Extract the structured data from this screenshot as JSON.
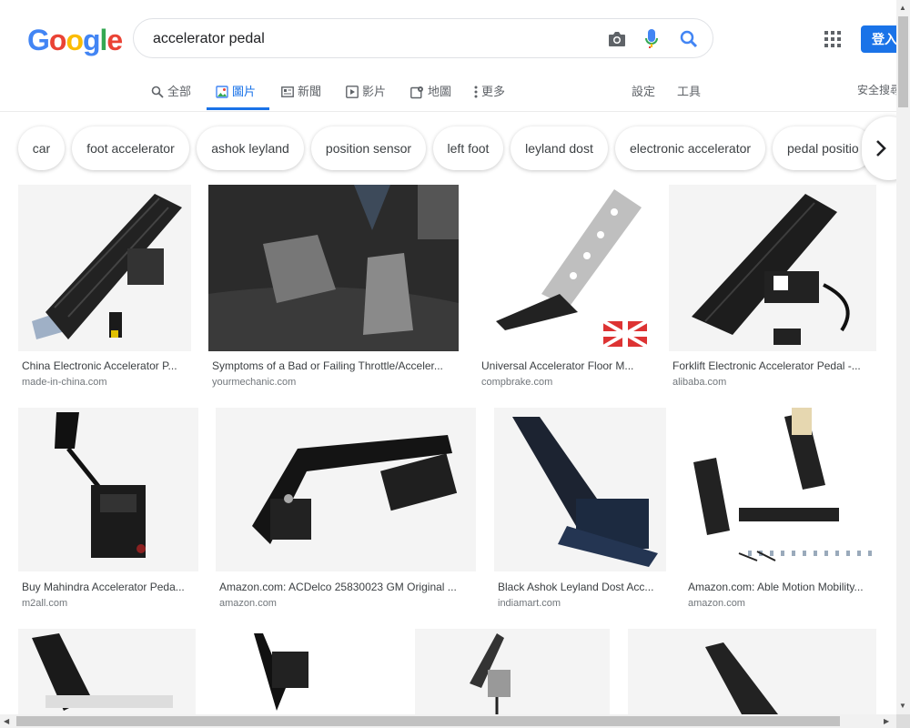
{
  "logo": {
    "letters": [
      "G",
      "o",
      "o",
      "g",
      "l",
      "e"
    ],
    "colors": [
      "#4285F4",
      "#EA4335",
      "#FBBC05",
      "#4285F4",
      "#34A853",
      "#EA4335"
    ]
  },
  "search": {
    "value": "accelerator pedal",
    "camera_icon": "camera-icon",
    "mic_icon": "mic-icon",
    "search_icon": "search-icon"
  },
  "header": {
    "apps_icon": "apps-grid-icon",
    "signin_label": "登入"
  },
  "tabs": [
    {
      "label": "全部",
      "icon": "search-icon"
    },
    {
      "label": "圖片",
      "icon": "image-icon"
    },
    {
      "label": "新聞",
      "icon": "news-icon"
    },
    {
      "label": "影片",
      "icon": "video-icon"
    },
    {
      "label": "地圖",
      "icon": "map-icon"
    },
    {
      "label": "更多",
      "icon": "more-icon"
    }
  ],
  "tools": {
    "settings": "設定",
    "tools": "工具",
    "safe_search": "安全搜尋"
  },
  "chips": [
    "car",
    "foot accelerator",
    "ashok leyland",
    "position sensor",
    "left foot",
    "leyland dost",
    "electronic accelerator",
    "pedal positio"
  ],
  "results": [
    {
      "caption": "China Electronic Accelerator P...",
      "source": "made-in-china.com"
    },
    {
      "caption": "Symptoms of a Bad or Failing Throttle/Acceler...",
      "source": "yourmechanic.com"
    },
    {
      "caption": "Universal Accelerator Floor M...",
      "source": "compbrake.com"
    },
    {
      "caption": "Forklift Electronic Accelerator Pedal -...",
      "source": "alibaba.com"
    },
    {
      "caption": "Buy Mahindra Accelerator Peda...",
      "source": "m2all.com"
    },
    {
      "caption": "Amazon.com: ACDelco 25830023 GM Original ...",
      "source": "amazon.com"
    },
    {
      "caption": "Black Ashok Leyland Dost Acc...",
      "source": "indiamart.com"
    },
    {
      "caption": "Amazon.com: Able Motion Mobility...",
      "source": "amazon.com"
    }
  ],
  "colors": {
    "accent": "#1a73e8",
    "text_secondary": "#70757a"
  }
}
